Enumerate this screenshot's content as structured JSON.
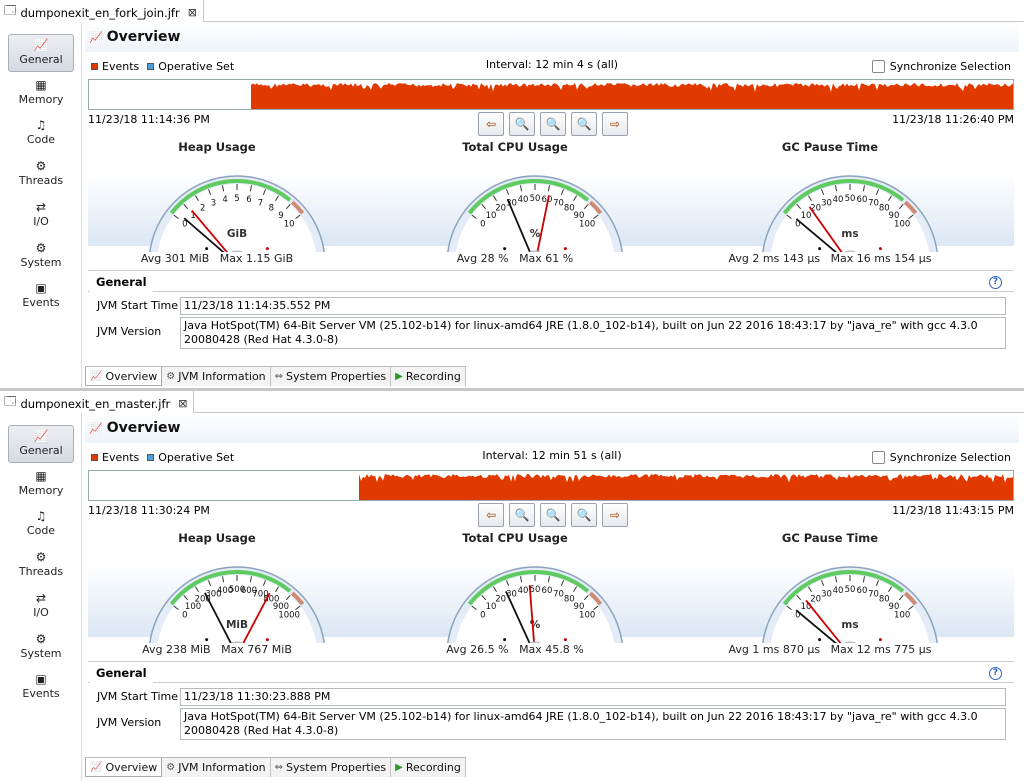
{
  "sidebar": {
    "items": [
      {
        "label": "General",
        "icon": "general-icon"
      },
      {
        "label": "Memory",
        "icon": "memory-icon"
      },
      {
        "label": "Code",
        "icon": "code-icon"
      },
      {
        "label": "Threads",
        "icon": "threads-icon"
      },
      {
        "label": "I/O",
        "icon": "io-icon"
      },
      {
        "label": "System",
        "icon": "system-icon"
      },
      {
        "label": "Events",
        "icon": "events-icon"
      }
    ]
  },
  "common": {
    "overview_title": "Overview",
    "legend_events": "Events",
    "legend_operative": "Operative Set",
    "sync_label": "Synchronize Selection",
    "gauge_titles": [
      "Heap Usage",
      "Total CPU Usage",
      "GC Pause Time"
    ],
    "general_tab": "General",
    "jvm_start_label": "JVM Start Time",
    "jvm_version_label": "JVM Version",
    "bottom_tabs": [
      "Overview",
      "JVM Information",
      "System Properties",
      "Recording"
    ],
    "colors": {
      "events": "#e03a00",
      "operative": "#4aa0d8",
      "gauge_green": "#5fca5f",
      "needle_avg": "#111111",
      "needle_max": "#cc0000"
    }
  },
  "panes": [
    {
      "file_name": "dumponexit_en_fork_join.jfr",
      "interval": "Interval: 12 min 4 s (all)",
      "start_ts": "11/23/18 11:14:36 PM",
      "end_ts": "11/23/18 11:26:40 PM",
      "activity_start_fraction": 0.175,
      "heap": {
        "unit": "GiB",
        "ticks": [
          "0",
          "1",
          "2",
          "3",
          "4",
          "5",
          "6",
          "7",
          "8",
          "9",
          "10"
        ],
        "avg_value": 0.301,
        "max_value": 1.15,
        "scale_max": 10,
        "avg_text": "Avg 301 MiB",
        "max_text": "Max 1.15 GiB"
      },
      "cpu": {
        "unit": "%",
        "ticks": [
          "0",
          "10",
          "20",
          "30",
          "40",
          "50",
          "60",
          "70",
          "80",
          "90",
          "100"
        ],
        "avg_value": 28,
        "max_value": 61,
        "scale_max": 100,
        "avg_text": "Avg 28 %",
        "max_text": "Max 61 %"
      },
      "gc": {
        "unit": "ms",
        "ticks": [
          "0",
          "10",
          "20",
          "30",
          "40",
          "50",
          "60",
          "70",
          "80",
          "90",
          "100"
        ],
        "avg_value": 2.143,
        "max_value": 16.154,
        "scale_max": 100,
        "avg_text": "Avg 2 ms 143 µs",
        "max_text": "Max 16 ms 154 µs"
      },
      "jvm_start_time": "11/23/18 11:14:35.552 PM",
      "jvm_version": "Java HotSpot(TM) 64-Bit Server VM (25.102-b14) for linux-amd64 JRE (1.8.0_102-b14), built on Jun 22 2016 18:43:17 by \"java_re\" with gcc 4.3.0 20080428 (Red Hat 4.3.0-8)"
    },
    {
      "file_name": "dumponexit_en_master.jfr",
      "interval": "Interval: 12 min 51 s (all)",
      "start_ts": "11/23/18 11:30:24 PM",
      "end_ts": "11/23/18 11:43:15 PM",
      "activity_start_fraction": 0.292,
      "heap": {
        "unit": "MiB",
        "ticks": [
          "0",
          "100",
          "200",
          "300",
          "400",
          "500",
          "600",
          "700",
          "800",
          "900",
          "1000"
        ],
        "avg_value": 238,
        "max_value": 767,
        "scale_max": 1000,
        "avg_text": "Avg 238 MiB",
        "max_text": "Max 767 MiB"
      },
      "cpu": {
        "unit": "%",
        "ticks": [
          "0",
          "10",
          "20",
          "30",
          "40",
          "50",
          "60",
          "70",
          "80",
          "90",
          "100"
        ],
        "avg_value": 26.5,
        "max_value": 45.8,
        "scale_max": 100,
        "avg_text": "Avg 26.5 %",
        "max_text": "Max 45.8 %"
      },
      "gc": {
        "unit": "ms",
        "ticks": [
          "0",
          "10",
          "20",
          "30",
          "40",
          "50",
          "60",
          "70",
          "80",
          "90",
          "100"
        ],
        "avg_value": 1.87,
        "max_value": 12.775,
        "scale_max": 100,
        "avg_text": "Avg 1 ms 870 µs",
        "max_text": "Max 12 ms 775 µs"
      },
      "jvm_start_time": "11/23/18 11:30:23.888 PM",
      "jvm_version": "Java HotSpot(TM) 64-Bit Server VM (25.102-b14) for linux-amd64 JRE (1.8.0_102-b14), built on Jun 22 2016 18:43:17 by \"java_re\" with gcc 4.3.0 20080428 (Red Hat 4.3.0-8)"
    }
  ]
}
